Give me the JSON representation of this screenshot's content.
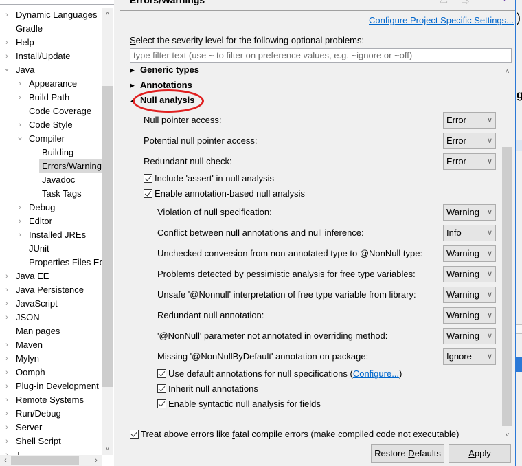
{
  "tree": {
    "items": [
      {
        "label": "Dynamic Languages",
        "level": 0,
        "expander": "collapsed"
      },
      {
        "label": "Gradle",
        "level": 0,
        "expander": "none"
      },
      {
        "label": "Help",
        "level": 0,
        "expander": "collapsed"
      },
      {
        "label": "Install/Update",
        "level": 0,
        "expander": "collapsed"
      },
      {
        "label": "Java",
        "level": 0,
        "expander": "expanded"
      },
      {
        "label": "Appearance",
        "level": 1,
        "expander": "collapsed"
      },
      {
        "label": "Build Path",
        "level": 1,
        "expander": "collapsed"
      },
      {
        "label": "Code Coverage",
        "level": 1,
        "expander": "none"
      },
      {
        "label": "Code Style",
        "level": 1,
        "expander": "collapsed"
      },
      {
        "label": "Compiler",
        "level": 1,
        "expander": "expanded"
      },
      {
        "label": "Building",
        "level": 2,
        "expander": "none"
      },
      {
        "label": "Errors/Warnings",
        "level": 2,
        "expander": "none",
        "selected": true
      },
      {
        "label": "Javadoc",
        "level": 2,
        "expander": "none"
      },
      {
        "label": "Task Tags",
        "level": 2,
        "expander": "none"
      },
      {
        "label": "Debug",
        "level": 1,
        "expander": "collapsed"
      },
      {
        "label": "Editor",
        "level": 1,
        "expander": "collapsed"
      },
      {
        "label": "Installed JREs",
        "level": 1,
        "expander": "collapsed"
      },
      {
        "label": "JUnit",
        "level": 1,
        "expander": "none"
      },
      {
        "label": "Properties Files Editor",
        "level": 1,
        "expander": "none"
      },
      {
        "label": "Java EE",
        "level": 0,
        "expander": "collapsed"
      },
      {
        "label": "Java Persistence",
        "level": 0,
        "expander": "collapsed"
      },
      {
        "label": "JavaScript",
        "level": 0,
        "expander": "collapsed"
      },
      {
        "label": "JSON",
        "level": 0,
        "expander": "collapsed"
      },
      {
        "label": "Man pages",
        "level": 0,
        "expander": "none"
      },
      {
        "label": "Maven",
        "level": 0,
        "expander": "collapsed"
      },
      {
        "label": "Mylyn",
        "level": 0,
        "expander": "collapsed"
      },
      {
        "label": "Oomph",
        "level": 0,
        "expander": "collapsed"
      },
      {
        "label": "Plug-in Development",
        "level": 0,
        "expander": "collapsed"
      },
      {
        "label": "Remote Systems",
        "level": 0,
        "expander": "collapsed"
      },
      {
        "label": "Run/Debug",
        "level": 0,
        "expander": "collapsed"
      },
      {
        "label": "Server",
        "level": 0,
        "expander": "collapsed"
      },
      {
        "label": "Shell Script",
        "level": 0,
        "expander": "collapsed"
      },
      {
        "label": "T...",
        "level": 0,
        "expander": "collapsed"
      }
    ],
    "glyphs": {
      "collapsed": "›",
      "expanded": "⌄",
      "scroll_up": "˄",
      "scroll_down": "˅",
      "scroll_left": "‹",
      "scroll_right": "›"
    }
  },
  "page": {
    "title": "Errors/Warnings",
    "configure_link": "Configure Project Specific Settings...",
    "select_label_first": "S",
    "select_label_rest": "elect the severity level for the following optional problems:",
    "filter_placeholder": "type filter text (use ~ to filter on preference values, e.g. ~ignore or ~off)",
    "sections": [
      {
        "mnemonic": "G",
        "rest": "eneric types",
        "state": "collapsed"
      },
      {
        "mnemonic": "",
        "rest": "Annotations",
        "state": "collapsed"
      },
      {
        "mnemonic": "N",
        "rest": "ull analysis",
        "state": "expanded",
        "highlighted": true
      }
    ],
    "null_analysis": {
      "top_options": [
        {
          "label": "Null pointer access:",
          "value": "Error"
        },
        {
          "label": "Potential null pointer access:",
          "value": "Error"
        },
        {
          "label": "Redundant null check:",
          "value": "Error"
        }
      ],
      "checkboxes_top": [
        {
          "label": "Include 'assert' in null analysis",
          "checked": true
        },
        {
          "label": "Enable annotation-based null analysis",
          "checked": true
        }
      ],
      "annotation_options": [
        {
          "label": "Violation of null specification:",
          "value": "Warning"
        },
        {
          "label": "Conflict between null annotations and null inference:",
          "value": "Info"
        },
        {
          "label": "Unchecked conversion from non-annotated type to @NonNull type:",
          "value": "Warning"
        },
        {
          "label": "Problems detected by pessimistic analysis for free type variables:",
          "value": "Warning"
        },
        {
          "label": "Unsafe '@Nonnull' interpretation of free type variable from library:",
          "value": "Warning"
        },
        {
          "label": "Redundant null annotation:",
          "value": "Warning"
        },
        {
          "label": "'@NonNull' parameter not annotated in overriding method:",
          "value": "Warning"
        },
        {
          "label": "Missing '@NonNullByDefault' annotation on package:",
          "value": "Ignore"
        }
      ],
      "checkboxes_bottom": [
        {
          "label": "Use default annotations for null specifications (",
          "link": "Configure...",
          "suffix": ")",
          "checked": true
        },
        {
          "label": "Inherit null annotations",
          "checked": true
        },
        {
          "label": "Enable syntactic null analysis for fields",
          "checked": true
        }
      ]
    },
    "fatal_checkbox": {
      "prefix": "Treat above errors like ",
      "mnemonic": "f",
      "suffix": "atal compile errors (make compiled code not executable)",
      "checked": true
    },
    "buttons": {
      "restore_prefix": "Restore ",
      "restore_mnemonic": "D",
      "restore_suffix": "efaults",
      "apply_mnemonic": "A",
      "apply_suffix": "pply"
    },
    "glyphs": {
      "collapsed_triangle": "▶",
      "expanded_triangle": "◢",
      "combo_arrow": "⌵",
      "scroll_up": "˄",
      "scroll_down": "˅",
      "nav_arrows": "⇦⇨",
      "menu_dot": "▾"
    }
  },
  "background_window": {
    "fragments": [
      ")",
      "g"
    ],
    "border_color": "#2b79d7"
  },
  "colors": {
    "link": "#0066cc",
    "highlight_ellipse": "#e02020",
    "selection": "#d9d9d9"
  }
}
